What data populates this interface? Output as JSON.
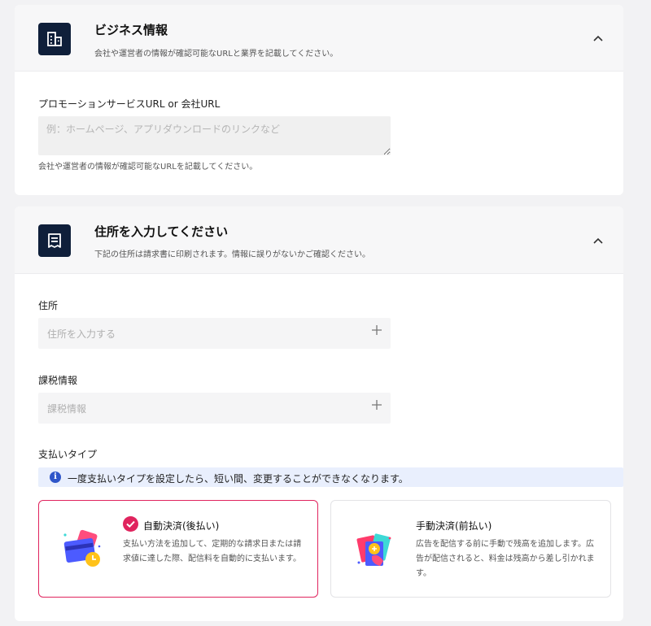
{
  "business": {
    "title": "ビジネス情報",
    "description": "会社や運営者の情報が確認可能なURLと業界を記載してください。",
    "url_label": "プロモーションサービスURL or 会社URL",
    "url_placeholder": "例：ホームページ、アプリダウンロードのリンクなど",
    "url_value": "",
    "url_help": "会社や運営者の情報が確認可能なURLを記載してください。",
    "icon": "building-icon"
  },
  "address": {
    "title": "住所を入力してください",
    "description": "下記の住所は請求書に印刷されます。情報に誤りがないかご確認ください。",
    "icon": "receipt-icon",
    "address_label": "住所",
    "address_placeholder": "住所を入力する",
    "tax_label": "課税情報",
    "tax_placeholder": "課税情報",
    "payment_label": "支払いタイプ",
    "notice": "一度支払いタイプを設定したら、短い間、変更することができなくなります。",
    "payment_options": [
      {
        "title": "自動決済(後払い)",
        "description": "支払い方法を追加して、定期的な請求日または請求値に達した際、配信料を自動的に支払います。",
        "selected": true
      },
      {
        "title": "手動決済(前払い)",
        "description": "広告を配信する前に手動で残高を追加します。広告が配信されると、料金は残高から差し引かれます。",
        "selected": false
      }
    ]
  },
  "colors": {
    "accent": "#e0245e",
    "icon_bg": "#0f1f3a",
    "notice_bg": "#e9effd",
    "info_blue": "#2f56c9"
  }
}
